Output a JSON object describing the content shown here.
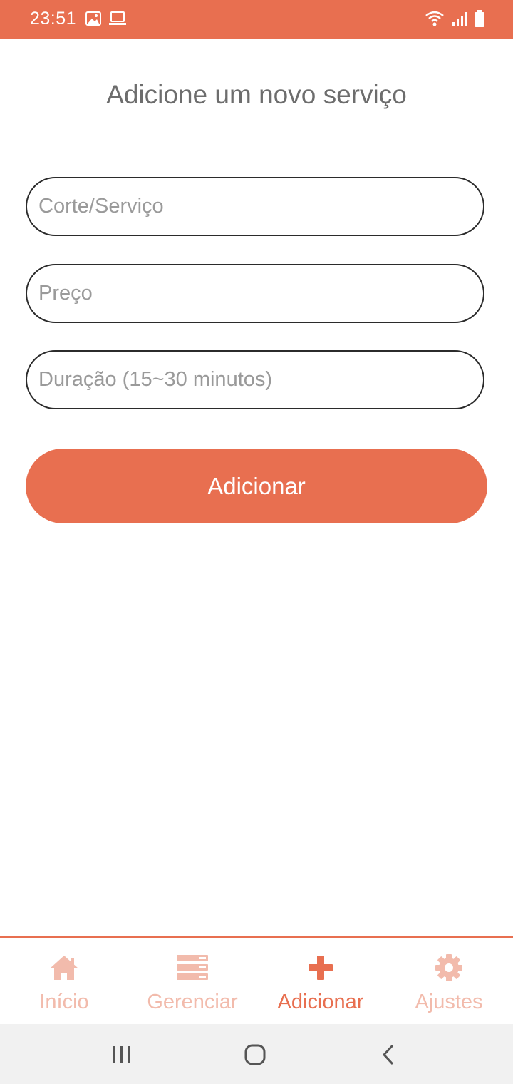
{
  "status_bar": {
    "time": "23:51",
    "left_icons": [
      "image-icon",
      "laptop-icon"
    ],
    "right_icons": [
      "wifi-icon",
      "signal-icon",
      "battery-icon"
    ],
    "background_color": "#E86F50"
  },
  "page": {
    "title": "Adicione um novo serviço"
  },
  "form": {
    "service_field": {
      "placeholder": "Corte/Serviço",
      "value": ""
    },
    "price_field": {
      "placeholder": "Preço",
      "value": ""
    },
    "duration_field": {
      "placeholder": "Duração (15~30 minutos)",
      "value": ""
    },
    "submit_label": "Adicionar"
  },
  "bottom_nav": {
    "items": [
      {
        "label": "Início",
        "icon": "home-icon",
        "active": false
      },
      {
        "label": "Gerenciar",
        "icon": "list-icon",
        "active": false
      },
      {
        "label": "Adicionar",
        "icon": "plus-icon",
        "active": true
      },
      {
        "label": "Ajustes",
        "icon": "gear-icon",
        "active": false
      }
    ],
    "active_color": "#E86F50",
    "inactive_color": "#F2BBAC"
  },
  "system_nav": {
    "buttons": [
      "recent-apps-icon",
      "home-circle-icon",
      "back-icon"
    ]
  }
}
